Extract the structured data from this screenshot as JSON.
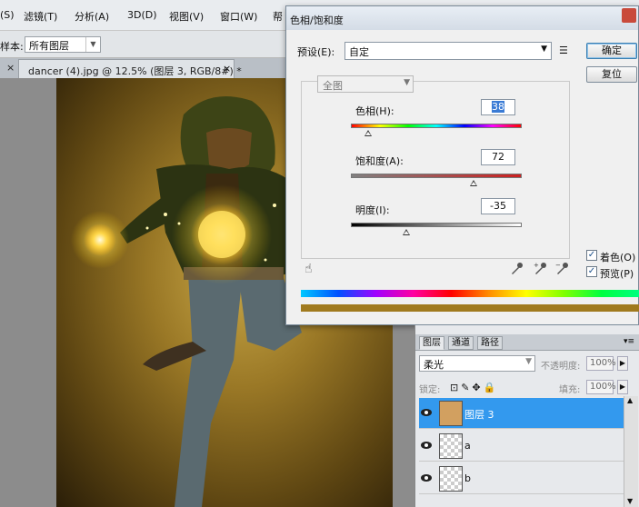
{
  "menubar": {
    "items": [
      "(S)",
      "滤镜(T)",
      "分析(A)",
      "3D(D)",
      "视图(V)",
      "窗口(W)",
      "帮"
    ]
  },
  "options": {
    "sample_label": "样本:",
    "sample_value": "所有图层"
  },
  "document": {
    "tab_label": "dancer (4).jpg @ 12.5% (图层 3, RGB/8#) *",
    "close": "×"
  },
  "dialog": {
    "title": "色相/饱和度",
    "preset_label": "预设(E):",
    "preset_value": "自定",
    "preset_menu_icon": "menu-lines-icon",
    "ok_label": "确定",
    "reset_label": "复位",
    "channel_value": "全图",
    "hue_label": "色相(H):",
    "hue_value": "38",
    "hue_fraction": 0.1,
    "saturation_label": "饱和度(A):",
    "saturation_value": "72",
    "saturation_fraction": 0.72,
    "lightness_label": "明度(I):",
    "lightness_value": "-35",
    "lightness_fraction": 0.325,
    "colorize_label": "着色(O)",
    "colorize_checked": true,
    "preview_label": "预览(P)",
    "preview_checked": true,
    "result_color": "#a07a1e"
  },
  "layers": {
    "tabs": [
      "图层",
      "通道",
      "路径"
    ],
    "blend_mode": "柔光",
    "opacity_label": "不透明度:",
    "opacity_value": "100%",
    "lock_label": "锁定:",
    "fill_label": "填充:",
    "fill_value": "100%",
    "rows": [
      {
        "name": "图层 3",
        "selected": true
      },
      {
        "name": "a",
        "selected": false
      },
      {
        "name": "b",
        "selected": false
      }
    ]
  }
}
